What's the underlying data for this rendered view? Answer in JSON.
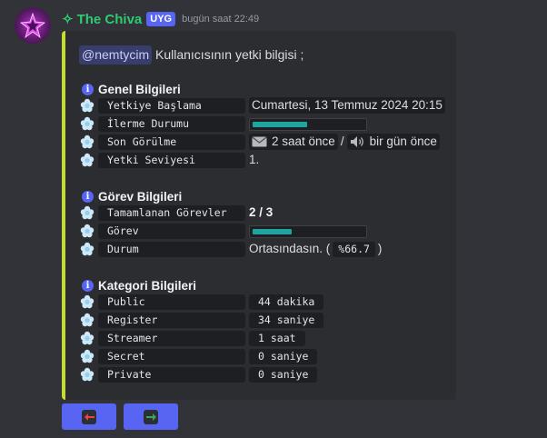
{
  "message": {
    "username_prefix": "✧",
    "username": "The Chiva",
    "role_tag": "UYG",
    "timestamp": "bugün saat 22:49"
  },
  "embed": {
    "accent_color": "#c5dc34",
    "mention": "@nemtycim",
    "intro": "Kullanıcısının yetki bilgisi ;",
    "general": {
      "title": "Genel Bilgileri",
      "rows": [
        {
          "label": "Yetkiye Başlama",
          "value": "Cumartesi, 13 Temmuz 2024 20:15"
        },
        {
          "label": "İlerme Durumu",
          "progress": 0.5
        },
        {
          "label": "Son Görülme",
          "value_a": "2 saat önce",
          "sep": "/",
          "value_b": "bir gün önce"
        },
        {
          "label": "Yetki Seviyesi",
          "value": "1."
        }
      ]
    },
    "task": {
      "title": "Görev Bilgileri",
      "rows": [
        {
          "label": "Tamamlanan Görevler",
          "value": "2 / 3"
        },
        {
          "label": "Görev",
          "progress": 0.36
        },
        {
          "label": "Durum",
          "value_prefix": "Ortasındasın. (",
          "value_code": "%66.7",
          "value_suffix": ")"
        }
      ]
    },
    "category": {
      "title": "Kategori Bilgileri",
      "rows": [
        {
          "label": "Public",
          "value": "44 dakika"
        },
        {
          "label": "Register",
          "value": "34 saniye"
        },
        {
          "label": "Streamer",
          "value": "1 saat"
        },
        {
          "label": "Secret",
          "value": "0 saniye"
        },
        {
          "label": "Private",
          "value": "0 saniye"
        }
      ]
    }
  },
  "buttons": {
    "prev_icon": "left-arrow-icon",
    "next_icon": "right-arrow-icon",
    "prev_color": "#ed4245",
    "next_color": "#3ba55d"
  },
  "icons": {
    "row_icon": "white-flower-icon",
    "section_icon": "info-icon"
  }
}
